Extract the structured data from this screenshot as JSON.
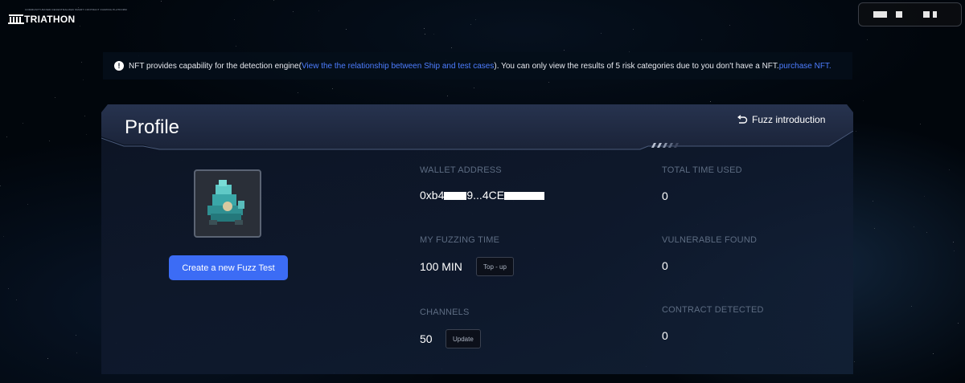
{
  "brand": {
    "name": "TRIATHON",
    "tagline": "COMMUNITY-BASED DECENTRALIZED SMART CONTRACT FUZZING PLATFORM"
  },
  "notice": {
    "icon": "exclamation-circle-icon",
    "text_before": "NFT provides capability for the detection engine(",
    "link_text": "View the the relationship between Ship and test cases",
    "text_middle": "). You can only view the results of 5 risk categories due to you don't have a NFT.",
    "purchase_link": "purchase NFT."
  },
  "profile": {
    "title": "Profile",
    "fuzz_intro_label": "Fuzz introduction",
    "create_button": "Create a new Fuzz Test",
    "wallet": {
      "label": "WALLET ADDRESS",
      "prefix": "0xb4",
      "middle": "9...4CE"
    },
    "fuzzing_time": {
      "label": "MY FUZZING TIME",
      "value": "100 MIN",
      "button": "Top - up"
    },
    "channels": {
      "label": "CHANNELS",
      "value": "50",
      "button": "Update"
    },
    "total_time": {
      "label": "TOTAL TIME USED",
      "value": "0"
    },
    "vulnerable": {
      "label": "VULNERABLE FOUND",
      "value": "0"
    },
    "contracts": {
      "label": "CONTRACT DETECTED",
      "value": "0"
    }
  },
  "colors": {
    "accent": "#3c6cf5",
    "link": "#4d7dff",
    "label": "#5d6c82"
  }
}
